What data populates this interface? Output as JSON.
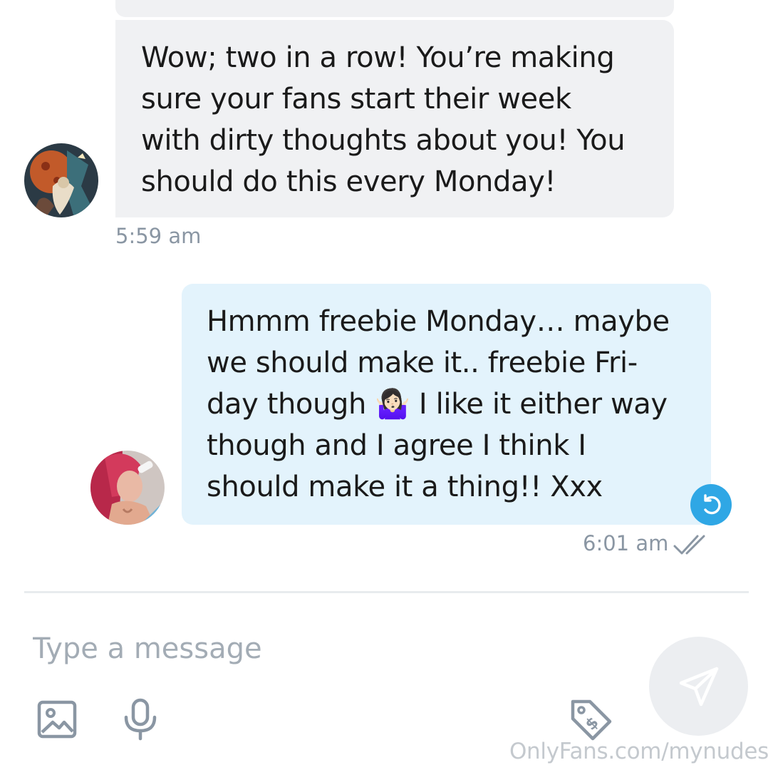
{
  "conversation": {
    "incoming": {
      "text": "Wow; two in a row! You’re making\nsure your fans start their week\nwith dirty thoughts about you! You\nshould do this every Monday!",
      "time": "5:59 am"
    },
    "outgoing": {
      "text": "Hmmm freebie Monday… maybe\nwe should make it.. freebie Fri-\nday though 🤷🏻‍♀️ I like it either way\nthough and I agree I think I\nshould make it a thing!! Xxx",
      "time": "6:01 am"
    }
  },
  "composer": {
    "placeholder": "Type a message"
  },
  "icons": {
    "undo": "undo-icon",
    "read": "double-check-icon",
    "image": "image-icon",
    "mic": "microphone-icon",
    "price": "price-tag-icon",
    "send": "send-icon"
  },
  "colors": {
    "incoming_bubble": "#f0f1f3",
    "outgoing_bubble": "#e3f3fc",
    "accent": "#2fa7e5",
    "muted_text": "#8a96a3"
  },
  "watermark": "OnlyFans.com/mynudes"
}
